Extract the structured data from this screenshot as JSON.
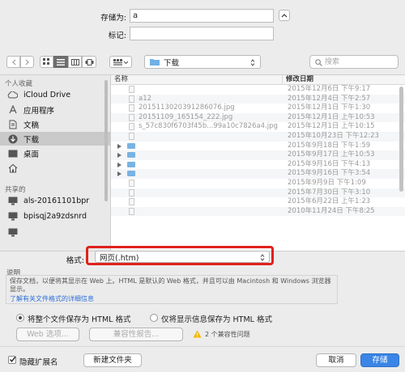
{
  "save": {
    "save_as_label": "存储为:",
    "save_as_value": "a",
    "tags_label": "标记:",
    "tags_value": ""
  },
  "toolbar": {
    "location": "下载",
    "search_placeholder": "搜索"
  },
  "sidebar": {
    "favorites_header": "个人收藏",
    "shared_header": "共享的",
    "items": [
      {
        "label": "iCloud Drive",
        "icon": "cloud-icon"
      },
      {
        "label": "应用程序",
        "icon": "apps-icon"
      },
      {
        "label": "文稿",
        "icon": "document-icon"
      },
      {
        "label": "下载",
        "icon": "download-icon"
      },
      {
        "label": "桌面",
        "icon": "desktop-icon"
      },
      {
        "label": "",
        "icon": "home-icon"
      }
    ],
    "shared": [
      {
        "label": "als-20161101bpr",
        "icon": "monitor-icon"
      },
      {
        "label": "bpisqj2a9zdsnrd",
        "icon": "monitor-icon"
      }
    ]
  },
  "files": {
    "col_name": "名称",
    "col_date": "修改日期",
    "rows": [
      {
        "name": "",
        "date": "2015年12月6日 下午9:17",
        "kind": "file"
      },
      {
        "name": "a12",
        "date": "2015年12月4日 下午2:57",
        "kind": "file"
      },
      {
        "name": "201511302039128607​6.jpg",
        "date": "2015年12月1日 下午1:30",
        "kind": "file"
      },
      {
        "name": "20151109_165154_222.jpg",
        "date": "2015年12月1日 上午10:53",
        "kind": "file"
      },
      {
        "name": "s_57c830f6703f45b...99a10c7826a4.jpg",
        "date": "2015年12月1日 上午10:15",
        "kind": "file"
      },
      {
        "name": "",
        "date": "2015年10月23日 下午12:23",
        "kind": "file"
      },
      {
        "name": "",
        "date": "2015年9月18日 下午1:59",
        "kind": "folder"
      },
      {
        "name": "",
        "date": "2015年9月17日 上午10:53",
        "kind": "folder"
      },
      {
        "name": "",
        "date": "2015年9月16日 下午4:13",
        "kind": "folder"
      },
      {
        "name": "",
        "date": "2015年9月16日 下午3:54",
        "kind": "folder"
      },
      {
        "name": "",
        "date": "2015年9月9日 下午1:09",
        "kind": "file"
      },
      {
        "name": "",
        "date": "2015年7月30日 下午3:10",
        "kind": "file"
      },
      {
        "name": "",
        "date": "2015年6月22日 上午1:23",
        "kind": "file"
      },
      {
        "name": "",
        "date": "2010年11月24日 下午8:25",
        "kind": "file"
      }
    ]
  },
  "format": {
    "label": "格式:",
    "value": "网页(.htm)"
  },
  "description": {
    "heading": "说明",
    "text": "保存文档，以便将其显示在 Web 上。HTML 是默认的 Web 格式，并且可以由 Macintosh 和 Windows 浏览器显示。",
    "link": "了解有关文件格式的详细信息"
  },
  "options": {
    "radio1": "将整个文件保存为 HTML 格式",
    "radio2": "仅将显示信息保存为 HTML 格式",
    "web_options": "Web 选项...",
    "compat_report": "兼容性报告...",
    "compat_warning": "2 个兼容性问题"
  },
  "bottom": {
    "hide_ext": "隐藏扩展名",
    "new_folder": "新建文件夹",
    "cancel": "取消",
    "save": "存储"
  },
  "colors": {
    "highlight": "#e0211b",
    "accent": "#2d6fd8",
    "warning": "#f2b705"
  }
}
